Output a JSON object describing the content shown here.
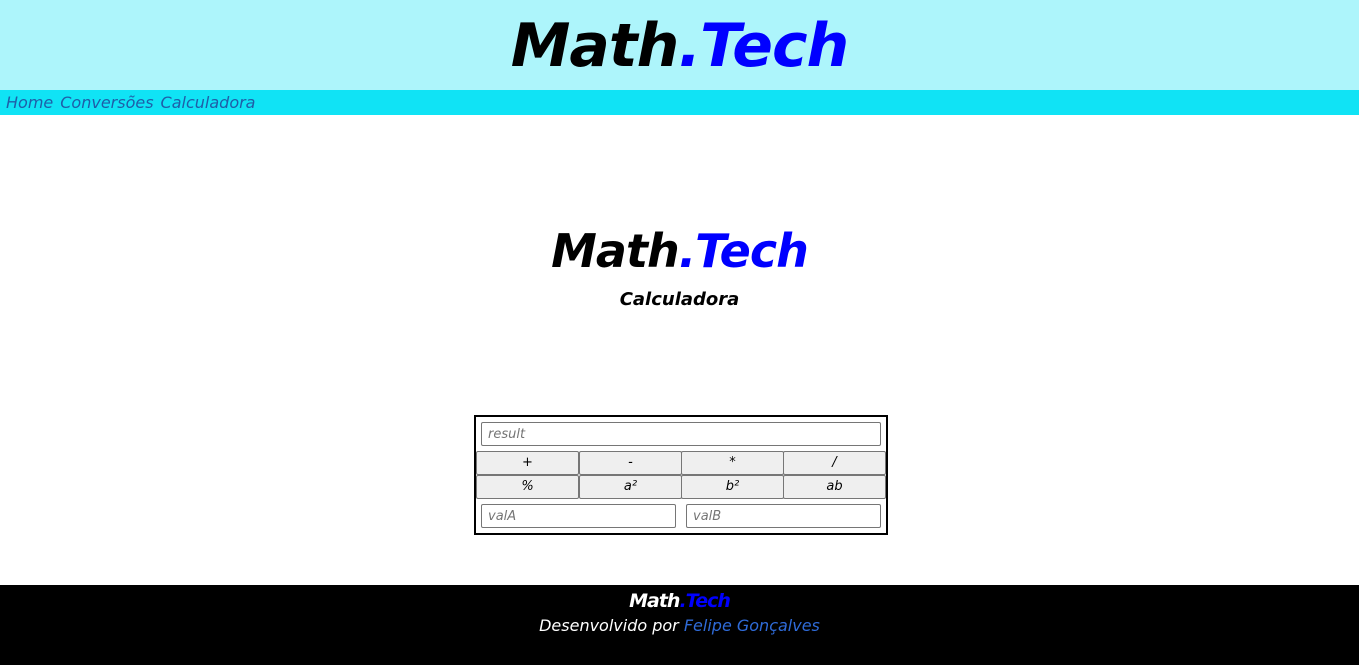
{
  "header": {
    "brand_part1": "Math",
    "brand_part2": ".Tech"
  },
  "nav": {
    "items": [
      {
        "label": "Home"
      },
      {
        "label": "Conversões"
      },
      {
        "label": "Calculadora"
      }
    ]
  },
  "hero": {
    "brand_part1": "Math",
    "brand_part2": ".Tech",
    "subtitle": "Calculadora"
  },
  "calculator": {
    "result_placeholder": "result",
    "vala_placeholder": "valA",
    "valb_placeholder": "valB",
    "buttons": [
      {
        "label": "+"
      },
      {
        "label": "-"
      },
      {
        "label": "*"
      },
      {
        "label": "/"
      },
      {
        "label": "%"
      },
      {
        "label": "a²"
      },
      {
        "label": "b²"
      },
      {
        "label": "ab"
      }
    ]
  },
  "footer": {
    "brand_part1": "Math",
    "brand_part2": ".Tech",
    "credit_prefix": "Desenvolvido por",
    "author": "Felipe Gonçalves"
  },
  "colors": {
    "header_bg": "#adf5fb",
    "nav_bg": "#10e3f5",
    "brand_blue": "#0000ff",
    "link_blue": "#2f6bd8",
    "footer_bg": "#000000"
  }
}
